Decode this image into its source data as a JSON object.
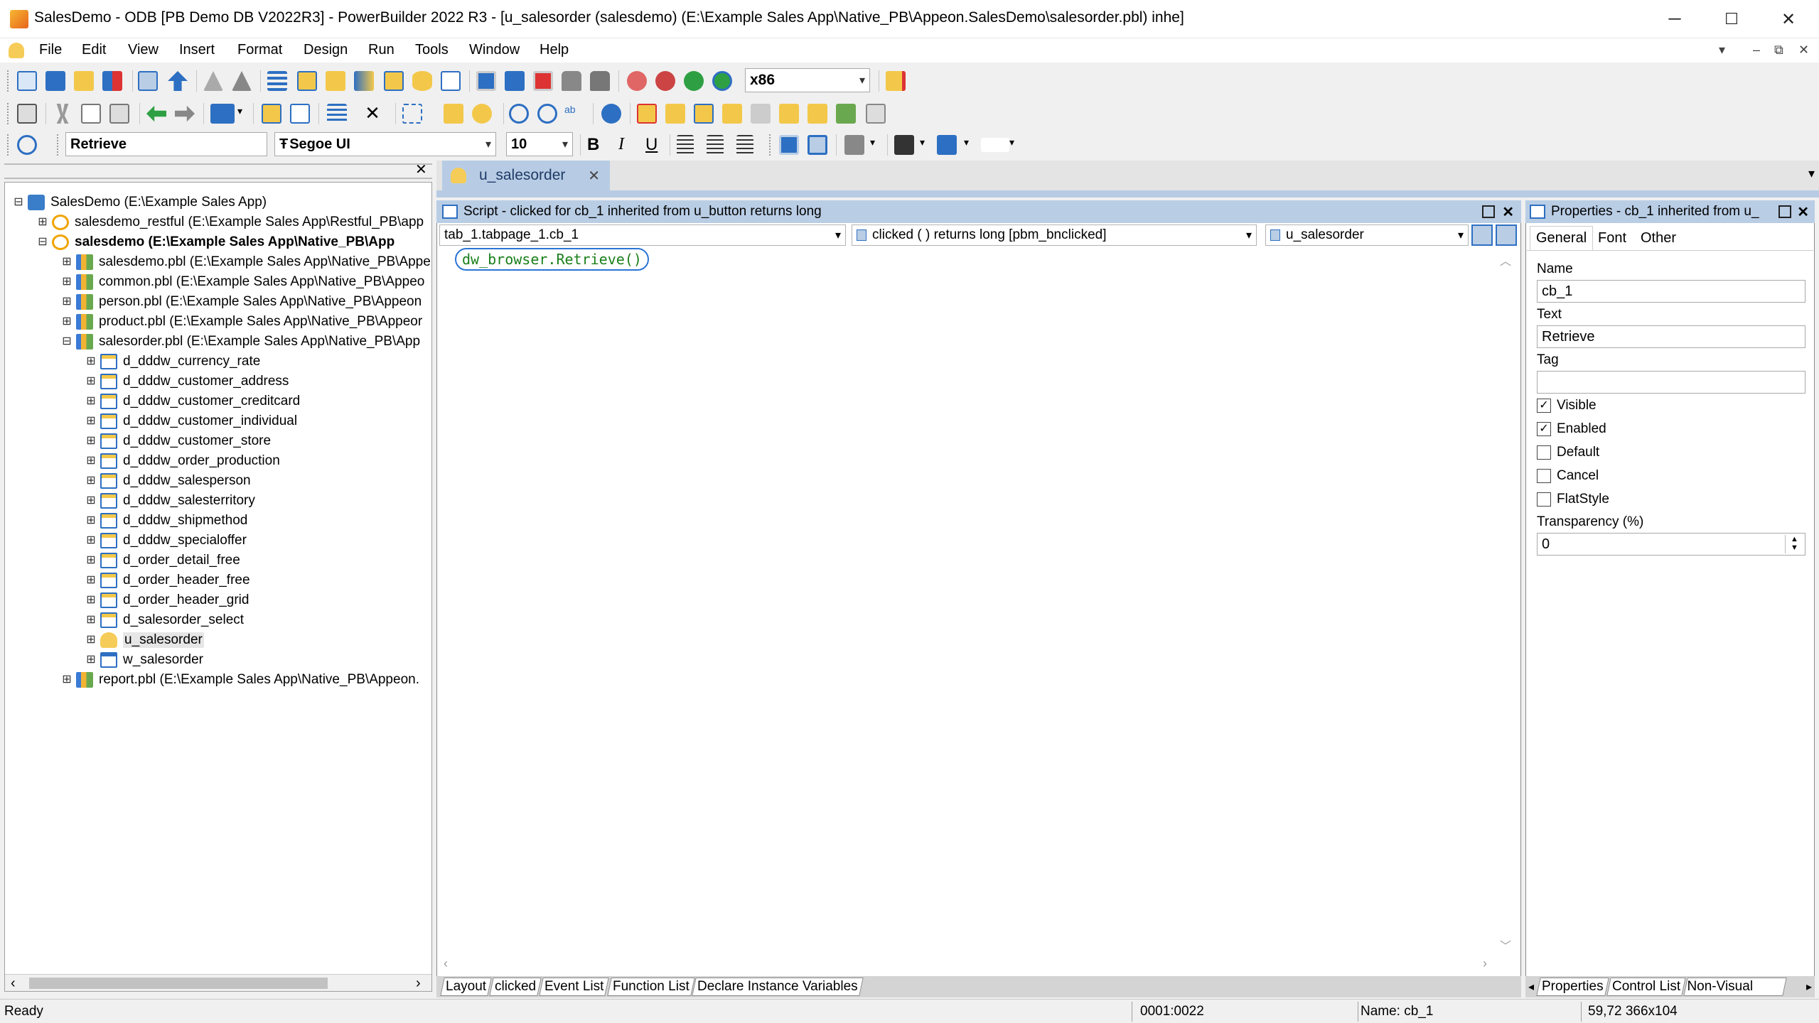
{
  "window": {
    "title": "SalesDemo - ODB [PB Demo DB V2022R3]  - PowerBuilder 2022 R3 - [u_salesorder (salesdemo) (E:\\Example Sales App\\Native_PB\\Appeon.SalesDemo\\salesorder.pbl) inhe]",
    "minimize": "─",
    "maximize": "☐",
    "close": "✕"
  },
  "menu": {
    "items": [
      "File",
      "Edit",
      "View",
      "Insert",
      "Format",
      "Design",
      "Run",
      "Tools",
      "Window",
      "Help"
    ],
    "mdi_dropdown": "▾",
    "mdi_minimize": "–",
    "mdi_restore": "⧉",
    "mdi_close": "✕"
  },
  "toolbar": {
    "platform_value": "x86",
    "object_text_value": "Retrieve",
    "font_name": "Segoe UI",
    "font_prefix": "Ŧ",
    "font_size": "10",
    "bold": "B",
    "italic": "I",
    "underline": "U"
  },
  "tree": {
    "close": "✕",
    "nodes": [
      {
        "indent": 0,
        "expander": "⊟",
        "icon": "app",
        "label": "SalesDemo (E:\\Example Sales App)",
        "bold": false
      },
      {
        "indent": 1,
        "expander": "⊞",
        "icon": "target",
        "label": "salesdemo_restful (E:\\Example Sales App\\Restful_PB\\app",
        "bold": false
      },
      {
        "indent": 1,
        "expander": "⊟",
        "icon": "target",
        "label": "salesdemo (E:\\Example Sales App\\Native_PB\\App",
        "bold": true
      },
      {
        "indent": 2,
        "expander": "⊞",
        "icon": "pbl",
        "label": "salesdemo.pbl (E:\\Example Sales App\\Native_PB\\Appe",
        "bold": false
      },
      {
        "indent": 2,
        "expander": "⊞",
        "icon": "pbl",
        "label": "common.pbl (E:\\Example Sales App\\Native_PB\\Appeo",
        "bold": false
      },
      {
        "indent": 2,
        "expander": "⊞",
        "icon": "pbl",
        "label": "person.pbl (E:\\Example Sales App\\Native_PB\\Appeon",
        "bold": false
      },
      {
        "indent": 2,
        "expander": "⊞",
        "icon": "pbl",
        "label": "product.pbl (E:\\Example Sales App\\Native_PB\\Appeor",
        "bold": false
      },
      {
        "indent": 2,
        "expander": "⊟",
        "icon": "pbl",
        "label": "salesorder.pbl (E:\\Example Sales App\\Native_PB\\App",
        "bold": false
      },
      {
        "indent": 3,
        "expander": "⊞",
        "icon": "dw",
        "label": "d_dddw_currency_rate",
        "bold": false
      },
      {
        "indent": 3,
        "expander": "⊞",
        "icon": "dw",
        "label": "d_dddw_customer_address",
        "bold": false
      },
      {
        "indent": 3,
        "expander": "⊞",
        "icon": "dw",
        "label": "d_dddw_customer_creditcard",
        "bold": false
      },
      {
        "indent": 3,
        "expander": "⊞",
        "icon": "dw",
        "label": "d_dddw_customer_individual",
        "bold": false
      },
      {
        "indent": 3,
        "expander": "⊞",
        "icon": "dw",
        "label": "d_dddw_customer_store",
        "bold": false
      },
      {
        "indent": 3,
        "expander": "⊞",
        "icon": "dw",
        "label": "d_dddw_order_production",
        "bold": false
      },
      {
        "indent": 3,
        "expander": "⊞",
        "icon": "dw",
        "label": "d_dddw_salesperson",
        "bold": false
      },
      {
        "indent": 3,
        "expander": "⊞",
        "icon": "dw",
        "label": "d_dddw_salesterritory",
        "bold": false
      },
      {
        "indent": 3,
        "expander": "⊞",
        "icon": "dw",
        "label": "d_dddw_shipmethod",
        "bold": false
      },
      {
        "indent": 3,
        "expander": "⊞",
        "icon": "dw",
        "label": "d_dddw_specialoffer",
        "bold": false
      },
      {
        "indent": 3,
        "expander": "⊞",
        "icon": "dw",
        "label": "d_order_detail_free",
        "bold": false
      },
      {
        "indent": 3,
        "expander": "⊞",
        "icon": "dw",
        "label": "d_order_header_free",
        "bold": false
      },
      {
        "indent": 3,
        "expander": "⊞",
        "icon": "dw",
        "label": "d_order_header_grid",
        "bold": false
      },
      {
        "indent": 3,
        "expander": "⊞",
        "icon": "dw",
        "label": "d_salesorder_select",
        "bold": false
      },
      {
        "indent": 3,
        "expander": "⊞",
        "icon": "uo",
        "label": "u_salesorder",
        "bold": false,
        "selected": true
      },
      {
        "indent": 3,
        "expander": "⊞",
        "icon": "win",
        "label": "w_salesorder",
        "bold": false
      },
      {
        "indent": 2,
        "expander": "⊞",
        "icon": "pbl",
        "label": "report.pbl (E:\\Example Sales App\\Native_PB\\Appeon.",
        "bold": false
      }
    ],
    "scroll_left": "‹",
    "scroll_right": "›"
  },
  "editor": {
    "doc_tab": "u_salesorder",
    "doc_tab_close": "✕",
    "tab_strip_arrow": "▾",
    "script_title": "Script - clicked for cb_1 inherited from u_button returns long",
    "object_combo": "tab_1.tabpage_1.cb_1",
    "event_combo": "clicked ( )  returns long [pbm_bnclicked]",
    "ancestor_combo": "u_salesorder",
    "code": "dw_browser.Retrieve()",
    "bottom_tabs": [
      "Layout",
      "clicked",
      "Event List",
      "Function List",
      "Declare Instance Variables"
    ]
  },
  "properties": {
    "title": "Properties - cb_1  inherited  from  u_",
    "tabs": [
      "General",
      "Font",
      "Other"
    ],
    "name_label": "Name",
    "name_value": "cb_1",
    "text_label": "Text",
    "text_value": "Retrieve",
    "tag_label": "Tag",
    "tag_value": "",
    "checkboxes": [
      {
        "label": "Visible",
        "checked": true
      },
      {
        "label": "Enabled",
        "checked": true
      },
      {
        "label": "Default",
        "checked": false
      },
      {
        "label": "Cancel",
        "checked": false
      },
      {
        "label": "FlatStyle",
        "checked": false
      }
    ],
    "transparency_label": "Transparency (%)",
    "transparency_value": "0",
    "bottom_tabs": [
      "Properties",
      "Control List",
      "Non-Visual Obje"
    ]
  },
  "status": {
    "ready": "Ready",
    "position": "0001:0022",
    "name": "Name: cb_1",
    "coords": "59,72 366x104"
  },
  "colors": {
    "accent_header": "#b9cde5",
    "code_green": "#1a7f1a",
    "highlight_blue": "#2a74d6"
  }
}
